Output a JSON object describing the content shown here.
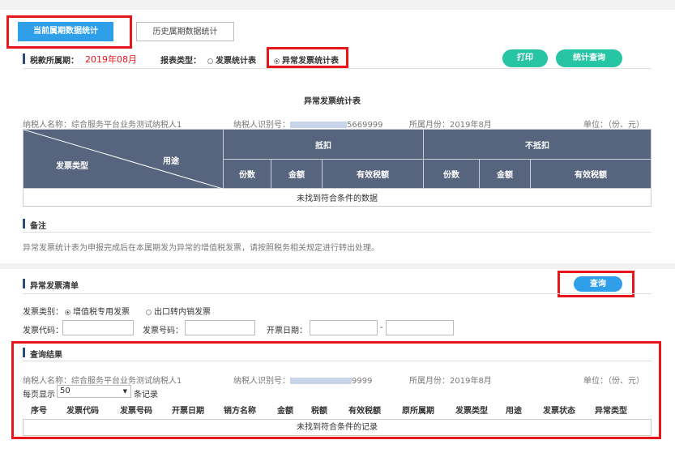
{
  "tabs": {
    "current": "当前属期数据统计",
    "history": "历史属期数据统计"
  },
  "period": {
    "label": "税款所属期：",
    "value": "2019年08月"
  },
  "report_type": {
    "label": "报表类型：",
    "option1": "发票统计表",
    "option2": "异常发票统计表"
  },
  "buttons": {
    "print": "打印",
    "stat_query": "统计查询",
    "query": "查询"
  },
  "stats_table": {
    "title": "异常发票统计表",
    "taxpayer_name": "纳税人名称：综合服务平台业务测试纳税人1",
    "taxpayer_id_label": "纳税人识别号：",
    "taxpayer_id_tail": "5669999",
    "month": "所属月份：2019年8月",
    "unit": "单位：（份、元）",
    "hdr_type": "发票类型",
    "hdr_use": "用途",
    "hdr_deduct": "抵扣",
    "hdr_nondeduct": "不抵扣",
    "sub_count": "份数",
    "sub_amount": "金额",
    "sub_valid_tax": "有效税额",
    "empty": "未找到符合条件的数据"
  },
  "notes": {
    "heading": "备注",
    "text": "异常发票统计表为申报完成后在本属期发为异常的增值税发票，请按照税务相关规定进行转出处理。"
  },
  "list": {
    "heading": "异常发票清单",
    "category_label": "发票类别：",
    "cat_opt1": "增值税专用发票",
    "cat_opt2": "出口转内销发票",
    "code_label": "发票代码：",
    "number_label": "发票号码：",
    "date_label": "开票日期：",
    "date_sep": "-"
  },
  "results": {
    "heading": "查询结果",
    "taxpayer_name": "纳税人名称：综合服务平台业务测试纳税人1",
    "taxpayer_id_label": "纳税人识别号：",
    "taxpayer_id_tail": "9999",
    "month": "所属月份：2019年8月",
    "unit": "单位：（份、元）",
    "per_page_label": "每页显示",
    "per_page_value": "50",
    "per_page_suffix": "条记录",
    "columns": [
      "序号",
      "发票代码",
      "发票号码",
      "开票日期",
      "销方名称",
      "金额",
      "税额",
      "有效税额",
      "原所属期",
      "发票类型",
      "用途",
      "发票状态",
      "异常类型"
    ],
    "empty": "未找到符合条件的记录"
  },
  "colors": {
    "accent": "#2f9fea",
    "green": "#27c5a4",
    "header": "#56647e",
    "highlight": "#e8161b"
  }
}
